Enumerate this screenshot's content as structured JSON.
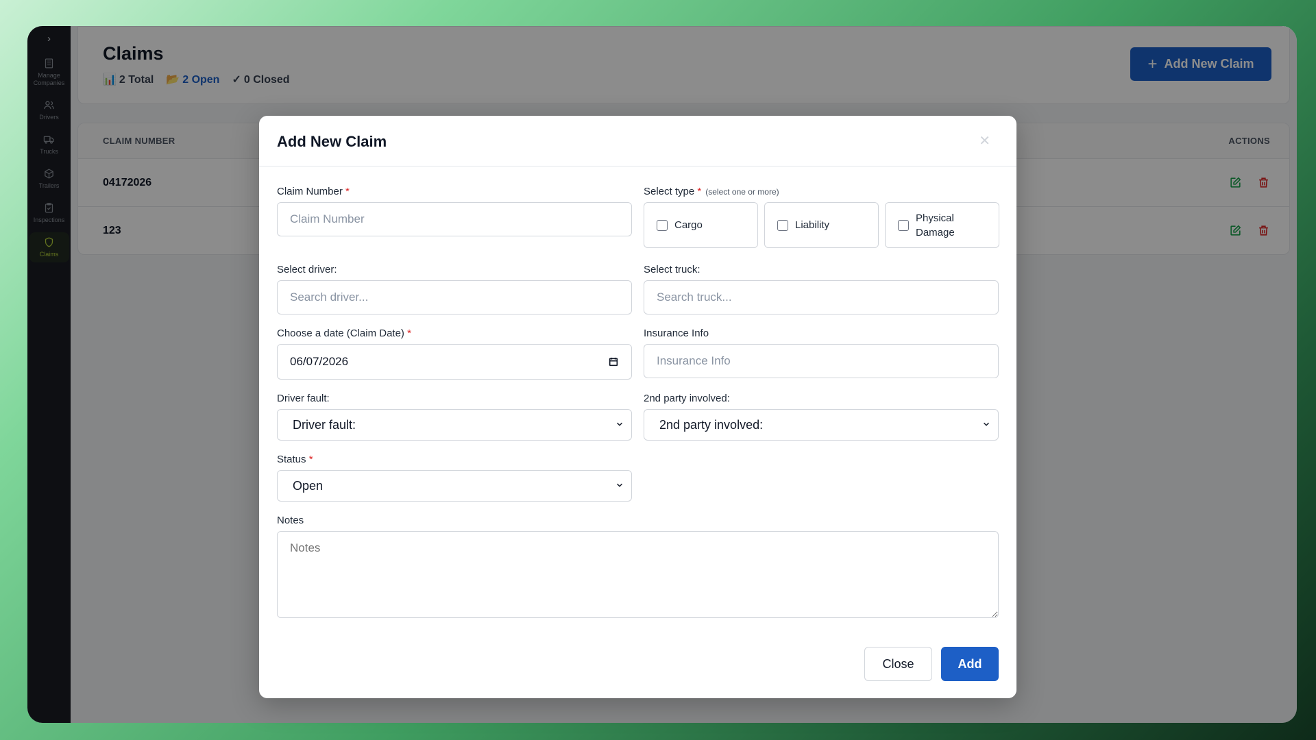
{
  "sidebar": {
    "expand_icon": "chevron-right-icon",
    "items": [
      {
        "label": "Manage Companies",
        "icon": "building-icon",
        "active": false
      },
      {
        "label": "Drivers",
        "icon": "users-icon",
        "active": false
      },
      {
        "label": "Trucks",
        "icon": "truck-icon",
        "active": false
      },
      {
        "label": "Trailers",
        "icon": "box-icon",
        "active": false
      },
      {
        "label": "Inspections",
        "icon": "clipboard-icon",
        "active": false
      },
      {
        "label": "Claims",
        "icon": "shield-icon",
        "active": true
      }
    ]
  },
  "header": {
    "title": "Claims",
    "stats": {
      "total": "2 Total",
      "open": "2 Open",
      "closed": "0 Closed"
    },
    "add_button_label": "Add New Claim"
  },
  "table": {
    "columns": {
      "claim_number": "CLAIM NUMBER",
      "actions": "ACTIONS"
    },
    "rows": [
      {
        "claim_number": "04172026"
      },
      {
        "claim_number": "123"
      }
    ]
  },
  "modal": {
    "title": "Add New Claim",
    "claim_number": {
      "label": "Claim Number",
      "placeholder": "Claim Number",
      "value": ""
    },
    "select_type": {
      "label": "Select type",
      "hint": "(select one or more)",
      "options": [
        "Cargo",
        "Liability",
        "Physical Damage"
      ]
    },
    "driver": {
      "label": "Select driver:",
      "placeholder": "Search driver..."
    },
    "truck": {
      "label": "Select truck:",
      "placeholder": "Search truck..."
    },
    "claim_date": {
      "label": "Choose a date (Claim Date)",
      "value": "06/07/2026"
    },
    "insurance": {
      "label": "Insurance Info",
      "placeholder": "Insurance Info"
    },
    "driver_fault": {
      "label": "Driver fault:",
      "selected": "Driver fault:"
    },
    "second_party": {
      "label": "2nd party involved:",
      "selected": "2nd party involved:"
    },
    "status": {
      "label": "Status",
      "selected": "Open"
    },
    "notes": {
      "label": "Notes",
      "placeholder": "Notes"
    },
    "close_label": "Close",
    "add_label": "Add",
    "required_mark": "*"
  },
  "colors": {
    "primary": "#1d5fc6",
    "danger": "#dc2626",
    "success": "#16a34a",
    "sidebar_bg": "#1b1d23",
    "sidebar_active": "#b5d23a"
  }
}
